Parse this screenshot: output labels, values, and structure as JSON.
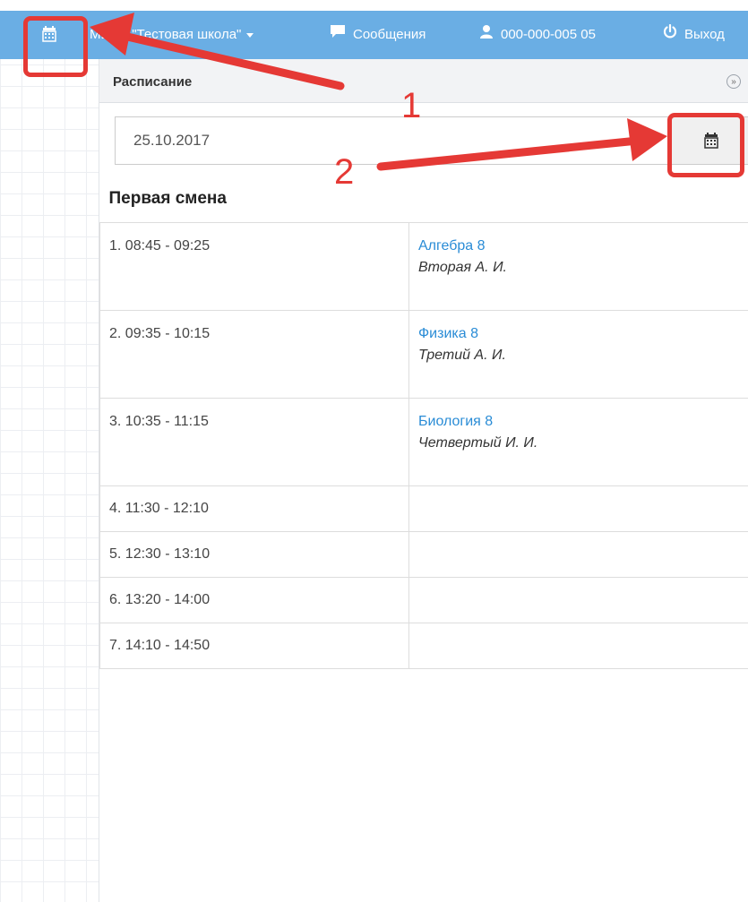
{
  "navbar": {
    "school_label": "МБОУ \"Тестовая школа\"",
    "messages_label": "Сообщения",
    "user_label": "000-000-005 05",
    "logout_label": "Выход"
  },
  "panel": {
    "title": "Расписание",
    "collapse_symbol": "»"
  },
  "date_input": {
    "value": "25.10.2017"
  },
  "schedule": {
    "shift_title": "Первая смена",
    "rows": [
      {
        "time": "1. 08:45 - 09:25",
        "subject": "Алгебра 8",
        "teacher": "Вторая А. И."
      },
      {
        "time": "2. 09:35 - 10:15",
        "subject": "Физика 8",
        "teacher": "Третий А. И."
      },
      {
        "time": "3. 10:35 - 11:15",
        "subject": "Биология 8",
        "teacher": "Четвертый И. И."
      },
      {
        "time": "4. 11:30 - 12:10",
        "subject": "",
        "teacher": ""
      },
      {
        "time": "5. 12:30 - 13:10",
        "subject": "",
        "teacher": ""
      },
      {
        "time": "6. 13:20 - 14:00",
        "subject": "",
        "teacher": ""
      },
      {
        "time": "7. 14:10 - 14:50",
        "subject": "",
        "teacher": ""
      }
    ]
  },
  "annotations": {
    "step1": "1",
    "step2": "2"
  },
  "icons": {
    "nav_calendar": "calendar-icon",
    "messages": "chat-icon",
    "user": "user-icon",
    "logout": "power-icon",
    "date_button": "calendar-icon"
  },
  "colors": {
    "navbar": "#6aaee4",
    "link": "#2a8cd6",
    "annotation": "#e53935"
  }
}
